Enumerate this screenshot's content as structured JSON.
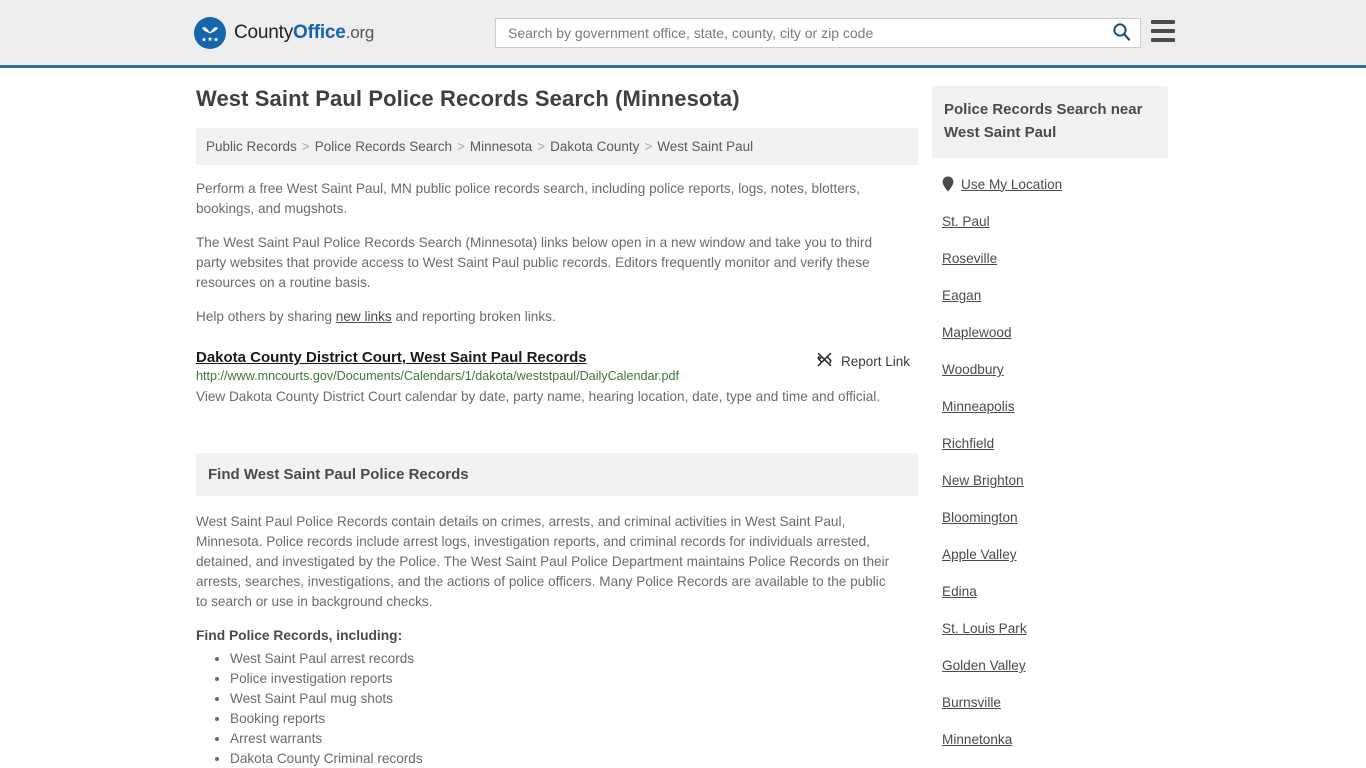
{
  "header": {
    "logo": {
      "icon": "countyoffice-eagle-logo-icon",
      "text_part1": "County",
      "text_part2": "Office",
      "text_part3": ".org"
    },
    "search": {
      "placeholder": "Search by government office, state, county, city or zip code",
      "value": "",
      "search_icon": "search-icon"
    },
    "menu_icon": "hamburger-menu-icon",
    "background_color": "#eeeeee",
    "border_color": "#2c6ca8"
  },
  "page_title": "West Saint Paul Police Records Search (Minnesota)",
  "breadcrumb": [
    "Public Records",
    "Police Records Search",
    "Minnesota",
    "Dakota County",
    "West Saint Paul"
  ],
  "breadcrumb_separator": ">",
  "intro": {
    "paragraph1": "Perform a free West Saint Paul, MN public police records search, including police reports, logs, notes, blotters, bookings, and mugshots.",
    "paragraph2": "The West Saint Paul Police Records Search (Minnesota) links below open in a new window and take you to third party websites that provide access to West Saint Paul public records. Editors frequently monitor and verify these resources on a routine basis.",
    "paragraph3_before": "Help others by sharing ",
    "paragraph3_link": "new links",
    "paragraph3_after": " and reporting broken links."
  },
  "result": {
    "title": "Dakota County District Court, West Saint Paul Records",
    "url": "http://www.mncourts.gov/Documents/Calendars/1/dakota/weststpaul/DailyCalendar.pdf",
    "description": "View Dakota County District Court calendar by date, party name, hearing location, date, type and time and official.",
    "report_label": "Report Link",
    "report_icon": "broken-link-icon",
    "url_color": "#3a7a3a"
  },
  "find_section": {
    "heading": "Find West Saint Paul Police Records",
    "body": "West Saint Paul Police Records contain details on crimes, arrests, and criminal activities in West Saint Paul, Minnesota. Police records include arrest logs, investigation reports, and criminal records for individuals arrested, detained, and investigated by the Police. The West Saint Paul Police Department maintains Police Records on their arrests, searches, investigations, and the actions of police officers. Many Police Records are available to the public to search or use in background checks.",
    "sub_heading": "Find Police Records, including:",
    "items": [
      "West Saint Paul arrest records",
      "Police investigation reports",
      "West Saint Paul mug shots",
      "Booking reports",
      "Arrest warrants",
      "Dakota County Criminal records"
    ]
  },
  "sidebar": {
    "heading": "Police Records Search near West Saint Paul",
    "use_my_location": {
      "label": "Use My Location",
      "icon": "map-pin-icon"
    },
    "cities": [
      "St. Paul",
      "Roseville",
      "Eagan",
      "Maplewood",
      "Woodbury",
      "Minneapolis",
      "Richfield",
      "New Brighton",
      "Bloomington",
      "Apple Valley",
      "Edina",
      "St. Louis Park",
      "Golden Valley",
      "Burnsville",
      "Minnetonka"
    ]
  }
}
